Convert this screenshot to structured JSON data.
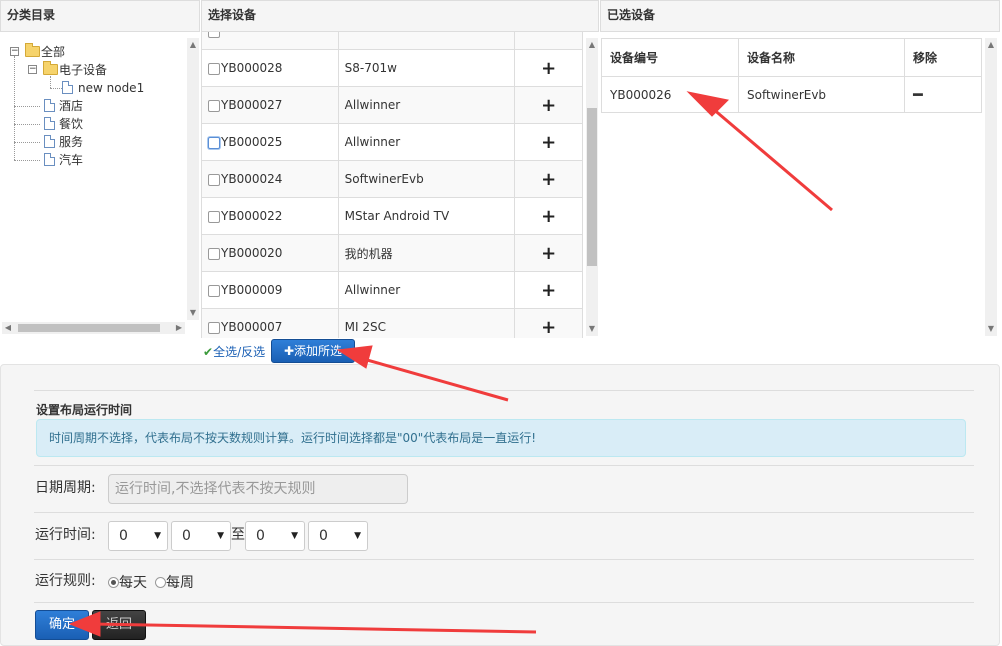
{
  "headers": {
    "category": "分类目录",
    "select_device": "选择设备",
    "selected_device": "已选设备"
  },
  "tree": {
    "root": "全部",
    "electronics": "电子设备",
    "new_node": "new node1",
    "hotel": "酒店",
    "dining": "餐饮",
    "service": "服务",
    "car": "汽车"
  },
  "devices": [
    {
      "id": "YB000028",
      "name": "S8-701w"
    },
    {
      "id": "YB000027",
      "name": "Allwinner"
    },
    {
      "id": "YB000025",
      "name": "Allwinner"
    },
    {
      "id": "YB000024",
      "name": "SoftwinerEvb"
    },
    {
      "id": "YB000022",
      "name": "MStar Android TV"
    },
    {
      "id": "YB000020",
      "name": "我的机器"
    },
    {
      "id": "YB000009",
      "name": "Allwinner"
    },
    {
      "id": "YB000007",
      "name": "MI 2SC"
    }
  ],
  "device_actions": {
    "select_all": "全选/反选",
    "add_selected": "添加所选"
  },
  "selected_table": {
    "columns": [
      "设备编号",
      "设备名称",
      "移除"
    ],
    "rows": [
      {
        "id": "YB000026",
        "name": "SoftwinerEvb"
      }
    ]
  },
  "form": {
    "section_title": "设置布局运行时间",
    "info": "时间周期不选择，代表布局不按天数规则计算。运行时间选择都是\"00\"代表布局是一直运行!",
    "date_label": "日期周期:",
    "date_placeholder": "运行时间,不选择代表不按天规则",
    "time_label": "运行时间:",
    "time_to": "至",
    "time_values": [
      "0",
      "0",
      "0",
      "0"
    ],
    "rule_label": "运行规则:",
    "rule_daily": "每天",
    "rule_weekly": "每周",
    "confirm": "确定",
    "back": "返回"
  },
  "colors": {
    "primary": "#1a5fb4",
    "alert_bg": "#d9edf7",
    "annotation": "#f03c3c"
  }
}
